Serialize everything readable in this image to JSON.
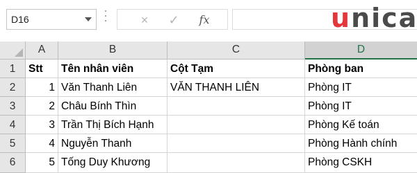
{
  "namebox": {
    "value": "D16"
  },
  "formula_bar": {
    "cancel_icon": "×",
    "enter_icon": "✓",
    "fx_label": "fx",
    "content": ""
  },
  "logo": {
    "text_u": "u",
    "text_rest": "nica"
  },
  "columns": [
    "A",
    "B",
    "C",
    "D"
  ],
  "rows": [
    {
      "num": "1",
      "stt": "Stt",
      "ten": "Tên nhân viên",
      "cot": "Cột Tạm",
      "phong": "Phòng ban",
      "header": true
    },
    {
      "num": "2",
      "stt": "1",
      "ten": "Văn Thanh Liên",
      "cot": "VĂN THANH LIÊN",
      "phong": "Phòng IT"
    },
    {
      "num": "3",
      "stt": "2",
      "ten": "Châu Bính Thìn",
      "cot": "",
      "phong": "Phòng IT"
    },
    {
      "num": "4",
      "stt": "3",
      "ten": "Trần Thị Bích Hạnh",
      "cot": "",
      "phong": "Phòng Kế toán"
    },
    {
      "num": "5",
      "stt": "4",
      "ten": "Nguyễn Thanh",
      "cot": "",
      "phong": "Phòng Hành chính"
    },
    {
      "num": "6",
      "stt": "5",
      "ten": "Tống Duy Khương",
      "cot": "",
      "phong": "Phòng CSKH"
    }
  ],
  "colors": {
    "selected_header": "#217346",
    "logo_red": "#e3373b",
    "logo_gray": "#4b4b4b"
  }
}
